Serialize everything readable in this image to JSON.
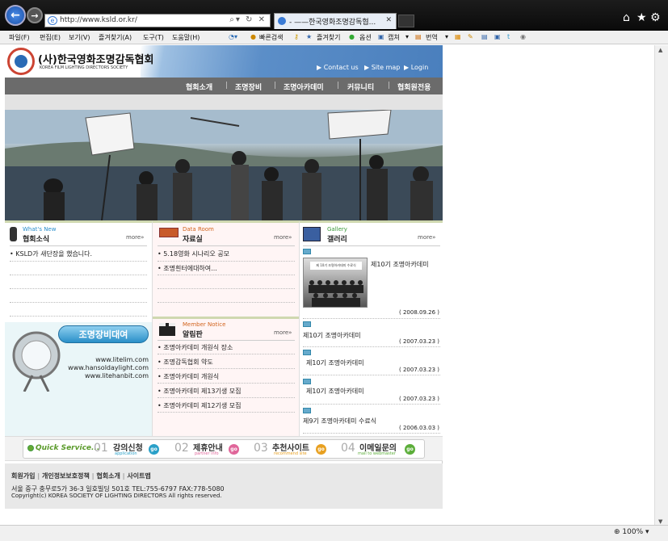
{
  "browser": {
    "url": "http://www.ksld.or.kr/",
    "tab_title": "- ——한국영화조명감독협...",
    "zoom": "100%",
    "menu": [
      "파일(F)",
      "편집(E)",
      "보기(V)",
      "즐겨찾기(A)",
      "도구(T)",
      "도움말(H)"
    ],
    "toolbar": {
      "quick_search": "빠른검색",
      "favorites": "즐겨찾기",
      "option": "옵션",
      "capture": "캡쳐",
      "translate": "번역"
    }
  },
  "site": {
    "org_name": "(사)한국영화조명감독협회",
    "org_sub": "KOREA FILM LIGHTING DIRECTORS SOCIETY",
    "top_links": [
      "Contact us",
      "Site map",
      "Login"
    ],
    "nav": [
      "협회소개",
      "조명장비",
      "조명아카데미",
      "커뮤니티",
      "협회원전용"
    ]
  },
  "news": {
    "en": "What's New",
    "ko": "협회소식",
    "more": "more",
    "items": [
      "KSLD가 새단장을 했습니다."
    ]
  },
  "data_room": {
    "en": "Data Room",
    "ko": "자료실",
    "more": "more",
    "items": [
      "5.18영화 시나리오 공모",
      "조명흰터에대하여..."
    ]
  },
  "notice": {
    "en": "Member Notice",
    "ko": "알림판",
    "more": "more",
    "items": [
      "조명아카데미 개원식 장소",
      "조명감독협회 약도",
      "조명아카데미 개원식",
      "조명아카데미 제13기생 모집",
      "조명아카데미 제12기생 모집"
    ]
  },
  "gallery": {
    "en": "Gallery",
    "ko": "갤러리",
    "more": "more",
    "featured": {
      "title": "제10기 조명아카데미",
      "date": "( 2008.09.26 )",
      "thumb_caption": "제 10기 조명아카데미 수료식"
    },
    "items": [
      {
        "title": "제10기 조명아카데미",
        "date": "( 2007.03.23 )"
      },
      {
        "title": "제10기 조명아카데미",
        "date": "( 2007.03.23 )"
      },
      {
        "title": "제10기 조명아카데미",
        "date": "( 2007.03.23 )"
      },
      {
        "title": "제9기 조명아카데미 수료식",
        "date": "( 2006.03.03 )"
      }
    ]
  },
  "rental": {
    "title": "조명장비대여",
    "links": [
      "www.litelim.com",
      "www.hansoldaylight.com",
      "www.litehanbit.com"
    ]
  },
  "quick": {
    "label": "Quick Service...",
    "items": [
      {
        "num": "01",
        "ko": "강의신청",
        "en": "application",
        "color": "#2aa0c8"
      },
      {
        "num": "02",
        "ko": "제휴안내",
        "en": "partner info",
        "color": "#e0669a"
      },
      {
        "num": "03",
        "ko": "추천사이트",
        "en": "recommend site",
        "color": "#e8a020"
      },
      {
        "num": "04",
        "ko": "이메일문의",
        "en": "mail to webmaster",
        "color": "#5cae3a"
      }
    ],
    "go": "go"
  },
  "footer": {
    "links": [
      "회원가입",
      "개인정보보호정책",
      "협회소개",
      "사이트맵"
    ],
    "address": "서울 중구 충무로5가 36-3 일호빌딩 501호  TEL:755-6797  FAX:778-5080",
    "copyright": "Copyright(c) KOREA SOCIETY OF LIGHTING DIRECTORS All rights reserved."
  }
}
